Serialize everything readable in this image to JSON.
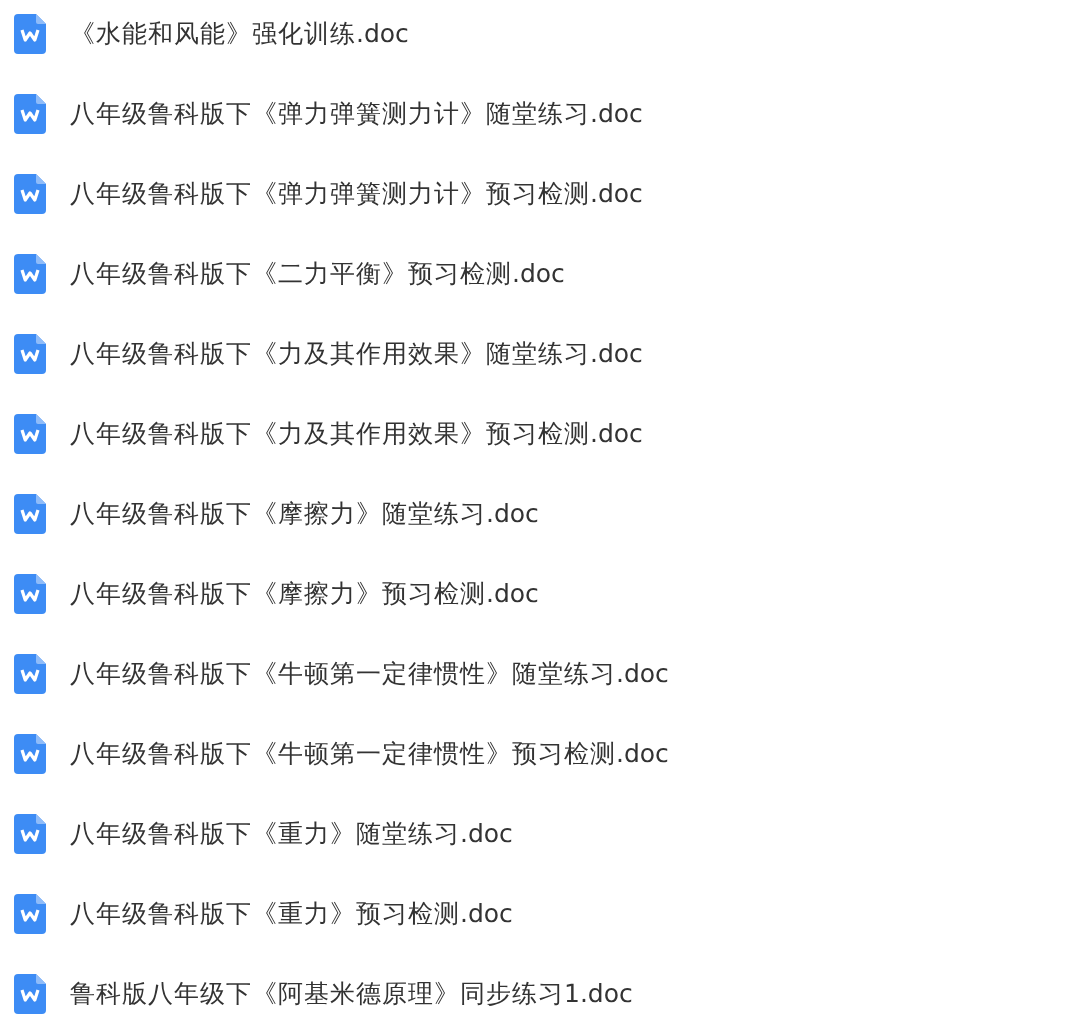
{
  "files": [
    {
      "name": "《水能和风能》强化训练.doc"
    },
    {
      "name": "八年级鲁科版下《弹力弹簧测力计》随堂练习.doc"
    },
    {
      "name": "八年级鲁科版下《弹力弹簧测力计》预习检测.doc"
    },
    {
      "name": "八年级鲁科版下《二力平衡》预习检测.doc"
    },
    {
      "name": "八年级鲁科版下《力及其作用效果》随堂练习.doc"
    },
    {
      "name": "八年级鲁科版下《力及其作用效果》预习检测.doc"
    },
    {
      "name": "八年级鲁科版下《摩擦力》随堂练习.doc"
    },
    {
      "name": "八年级鲁科版下《摩擦力》预习检测.doc"
    },
    {
      "name": "八年级鲁科版下《牛顿第一定律惯性》随堂练习.doc"
    },
    {
      "name": "八年级鲁科版下《牛顿第一定律惯性》预习检测.doc"
    },
    {
      "name": "八年级鲁科版下《重力》随堂练习.doc"
    },
    {
      "name": "八年级鲁科版下《重力》预习检测.doc"
    },
    {
      "name": "鲁科版八年级下《阿基米德原理》同步练习1.doc"
    }
  ]
}
